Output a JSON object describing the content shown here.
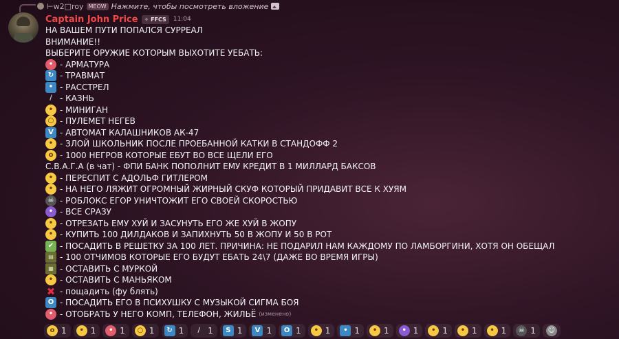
{
  "reply": {
    "author": "⊢w2□roy",
    "tag": "MEOW",
    "text": "Нажмите, чтобы посмотреть вложение"
  },
  "message": {
    "author": "Captain John Price",
    "tag": "✧ FFCS",
    "time": "11:04",
    "lines": [
      {
        "icon": "",
        "style": "",
        "glyph": "",
        "text": "НА ВАШЕМ ПУТИ ПОПАЛСЯ СУРРЕАЛ"
      },
      {
        "icon": "",
        "style": "",
        "glyph": "",
        "text": "ВНИМАНИЕ!!"
      },
      {
        "icon": "",
        "style": "",
        "glyph": "",
        "text": "ВЫБЕРИТЕ ОРУЖИЕ КОТОРЫМ ВЫХОТИТЕ УЕБАТЬ:"
      },
      {
        "icon": "red-angry-face-icon",
        "style": "red",
        "glyph": "•",
        "text": "- АРМАТУРА"
      },
      {
        "icon": "repeat-arrows-icon",
        "style": "blue",
        "glyph": "↻",
        "text": "- ТРАВМАТ"
      },
      {
        "icon": "blue-figure-icon",
        "style": "blue",
        "glyph": "•",
        "text": "- РАССТРЕЛ"
      },
      {
        "icon": "knife-icon",
        "style": "plain",
        "glyph": "∕",
        "text": "- КАЗНЬ"
      },
      {
        "icon": "alien-face-icon",
        "style": "face",
        "glyph": "•",
        "text": "- МИНИГАН"
      },
      {
        "icon": "monocle-face-icon",
        "style": "face",
        "glyph": "○",
        "text": "- ПУЛЕМЕТ НЕГЕВ"
      },
      {
        "icon": "letter-v-icon",
        "style": "blue",
        "glyph": "V",
        "text": "- АВТОМАТ КАЛАШНИКОВ АК-47"
      },
      {
        "icon": "crying-laughing-face-icon",
        "style": "face",
        "glyph": "•",
        "text": "- ЗЛОЙ ШКОЛЬНИК ПОСЛЕ ПРОЕБАННОЙ КАТКИ В СТАНДОФФ 2"
      },
      {
        "icon": "astonished-face-icon",
        "style": "face",
        "glyph": "o",
        "text": "- 1000 НЕГРОВ КОТОРЫЕ ЕБУТ ВО ВСЕ ЩЕЛИ ЕГО"
      },
      {
        "icon": "",
        "style": "",
        "glyph": "",
        "text": "С.В.А.Г.А (в чат) - ФПИ БАНК ПОПОЛНИТ ЕМУ КРЕДИТ В 1 МИЛЛАРД БАКСОВ"
      },
      {
        "icon": "small-face-icon",
        "style": "face",
        "glyph": "•",
        "text": "- ПЕРЕСПИТ С АДОЛЬФ ГИТЛЕРОМ"
      },
      {
        "icon": "rolling-laughing-face-icon",
        "style": "face",
        "glyph": "•",
        "text": "- НА НЕГО ЛЯЖИТ ОГРОМНЫЙ ЖИРНЫЙ СКУФ КОТОРЫЙ ПРИДАВИТ ВСЕ К ХУЯМ"
      },
      {
        "icon": "skull-icon",
        "style": "dark",
        "glyph": "☠",
        "text": "- РОБЛОКС ЕГОР УНИЧТОЖИТ ЕГО СВОЕЙ СКОРОСТЬЮ"
      },
      {
        "icon": "purple-devil-face-icon",
        "style": "purple",
        "glyph": "•",
        "text": "- ВСЕ СРАЗУ"
      },
      {
        "icon": "smirking-face-icon",
        "style": "face",
        "glyph": "•",
        "text": "- ОТРЕЗАТЬ ЕМУ ХУЙ И ЗАСУНУТЬ ЕГО ЖЕ ХУЙ В ЖОПУ"
      },
      {
        "icon": "grinning-face-icon",
        "style": "face",
        "glyph": "•",
        "text": "- КУПИТЬ 100 ДИЛДАКОВ И ЗАПИХНУТЬ 50 В ЖОПУ И 50 В РОТ"
      },
      {
        "icon": "check-mark-icon",
        "style": "green",
        "glyph": "✔",
        "text": "- ПОСАДИТЬ В РЕШЕТКУ ЗА 100 ЛЕТ. ПРИЧИНА: НЕ ПОДАРИЛ НАМ КАЖДОМУ ПО ЛАМБОРГИНИ, ХОТЯ ОН ОБЕЩАЛ"
      },
      {
        "icon": "film-strip-icon",
        "style": "film",
        "glyph": "▤",
        "text": "- 100 ОТЧИМОВ КОТОРЫЕ ЕГО БУДУТ ЕБАТЬ 24\\7 (ДАЖЕ ВО ВРЕМЯ ИГРЫ)"
      },
      {
        "icon": "image-icon",
        "style": "film",
        "glyph": "▦",
        "text": "- ОСТАВИТЬ С МУРКОЙ"
      },
      {
        "icon": "angry-face-icon",
        "style": "face",
        "glyph": "•",
        "text": "- ОСТАВИТЬ С МАНЬЯКОМ"
      },
      {
        "icon": "cross-mark-icon",
        "style": "cross",
        "glyph": "✖",
        "text": "- пощадить (фу блять)"
      },
      {
        "icon": "letter-o-icon",
        "style": "blue",
        "glyph": "O",
        "text": "- ПОСАДИТЬ ЕГО В ПСИХУШКУ С МУЗЫКОЙ СИГМА БОЯ"
      },
      {
        "icon": "red-hat-icon",
        "style": "red",
        "glyph": "•",
        "text": "- ОТОБРАТЬ У НЕГО КОМП, ТЕЛЕФОН, ЖИЛЬЁ"
      }
    ],
    "edited_label": "(изменено)"
  },
  "reactions": [
    {
      "icon": "astonished-face-icon",
      "style": "face",
      "glyph": "o",
      "count": "1"
    },
    {
      "icon": "crying-laughing-face-icon",
      "style": "face",
      "glyph": "•",
      "count": "1"
    },
    {
      "icon": "red-angry-face-icon",
      "style": "red",
      "glyph": "•",
      "count": "1"
    },
    {
      "icon": "monocle-face-icon",
      "style": "face",
      "glyph": "○",
      "count": "1"
    },
    {
      "icon": "repeat-arrows-icon",
      "style": "blue",
      "glyph": "↻",
      "count": "1"
    },
    {
      "icon": "knife-icon",
      "style": "plain",
      "glyph": "∕",
      "count": "1"
    },
    {
      "icon": "letter-s-icon",
      "style": "blue",
      "glyph": "S",
      "count": "1"
    },
    {
      "icon": "letter-v-icon",
      "style": "blue",
      "glyph": "V",
      "count": "1"
    },
    {
      "icon": "letter-o-icon",
      "style": "blue",
      "glyph": "O",
      "count": "1"
    },
    {
      "icon": "alien-face-icon",
      "style": "face",
      "glyph": "•",
      "count": "1"
    },
    {
      "icon": "blue-figure-icon",
      "style": "blue",
      "glyph": "•",
      "count": "1"
    },
    {
      "icon": "grinning-face-icon",
      "style": "face",
      "glyph": "•",
      "count": "1"
    },
    {
      "icon": "purple-devil-face-icon",
      "style": "purple",
      "glyph": "•",
      "count": "1"
    },
    {
      "icon": "rolling-laughing-face-icon",
      "style": "face",
      "glyph": "•",
      "count": "1"
    },
    {
      "icon": "small-face-icon",
      "style": "face",
      "glyph": "•",
      "count": "1"
    },
    {
      "icon": "smirking-face-icon",
      "style": "face",
      "glyph": "•",
      "count": "1"
    },
    {
      "icon": "skull-icon",
      "style": "dark",
      "glyph": "☠",
      "count": "1"
    }
  ],
  "add_reaction_icon": "add-reaction-icon"
}
